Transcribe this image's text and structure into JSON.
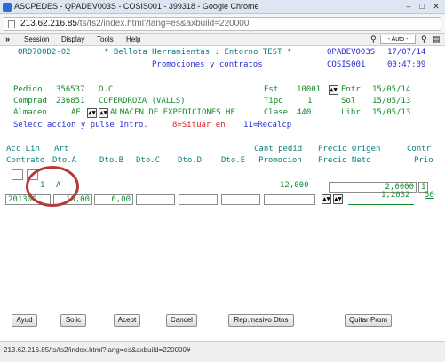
{
  "window": {
    "title": "ASCPEDES - QPADEV003S - COSIS001 - 399318 - Google Chrome",
    "controls": [
      "–",
      "□",
      "✕"
    ]
  },
  "address": {
    "host": "213.62.216.85",
    "path": "/ts/ts2/index.html?lang=es&axbuild=220000"
  },
  "menu": {
    "items": [
      "Session",
      "Display",
      "Tools",
      "Help"
    ],
    "zoom": "- Auto -"
  },
  "header": {
    "program": "ORD700D2-02",
    "company_line": "* Bellota Herramientas : Entorno TEST *",
    "subtitle": "Promociones y contratos",
    "device": "QPADEV003S",
    "date": "17/07/14",
    "user": "COSIS001",
    "time": "00:47:09"
  },
  "order": {
    "pedido_label": "Pedido",
    "pedido": "356537",
    "oc_label": "O.C.",
    "comprad_label": "Comprad",
    "comprad_code": "236851",
    "comprad_name": "COFERDROZA (VALLS)",
    "almacen_label": "Almacen",
    "almacen_code": "AE",
    "almacen_name": "ALMACEN DE EXPEDICIONES HE",
    "est_label": "Est",
    "est": "10001",
    "entr_label": "Entr",
    "entr": "15/05/14",
    "tipo_label": "Tipo",
    "tipo": "1",
    "sol_label": "Sol",
    "sol": "15/05/13",
    "clase_label": "Clase",
    "clase": "440",
    "libr_label": "Libr",
    "libr": "15/05/13"
  },
  "instructions": {
    "text": "Selecc accion y pulse Intro.",
    "f8": "8=Situar en",
    "f11": "11=Recalcp"
  },
  "columns": {
    "row1": [
      "Acc Lin",
      "Art",
      "Cant pedid",
      "Precio Origen",
      "Contr"
    ],
    "row2": [
      "Contrato",
      "Dto.A",
      "Dto.B",
      "Dto.C",
      "Dto.D",
      "Dto.E",
      "Promocion",
      "Precio Neto",
      "Prio"
    ]
  },
  "line": {
    "lin": "1",
    "art": "A",
    "cant_pedid": "12,000",
    "precio_origen": "2,0000",
    "contr": "1",
    "contrato": "201300",
    "dto_a": "13,00",
    "dto_b": "6,00",
    "dto_c": "",
    "dto_d": "",
    "dto_e": "",
    "precio_neto": "1,2032",
    "prio": "50"
  },
  "buttons": {
    "ayud": "Ayud",
    "solic": "Solic",
    "acept": "Acept",
    "cancel": "Cancel",
    "rep": "Rep.masivo Dtos",
    "quitar": "Quitar Prom"
  },
  "status": {
    "url": "213.62.216.85/ts/ts2/index.html?lang=es&axbuild=220000#"
  },
  "colors": {
    "input_fields": "#138a2a",
    "labels": "#2a2ad8",
    "headers": "#0b7f7f",
    "function_keys": "#d82020",
    "annotation_circle": "#b33a3a"
  },
  "icons": {
    "prompt_button": "prompt-arrows-icon",
    "page": "page-icon",
    "key": "key-icon"
  }
}
